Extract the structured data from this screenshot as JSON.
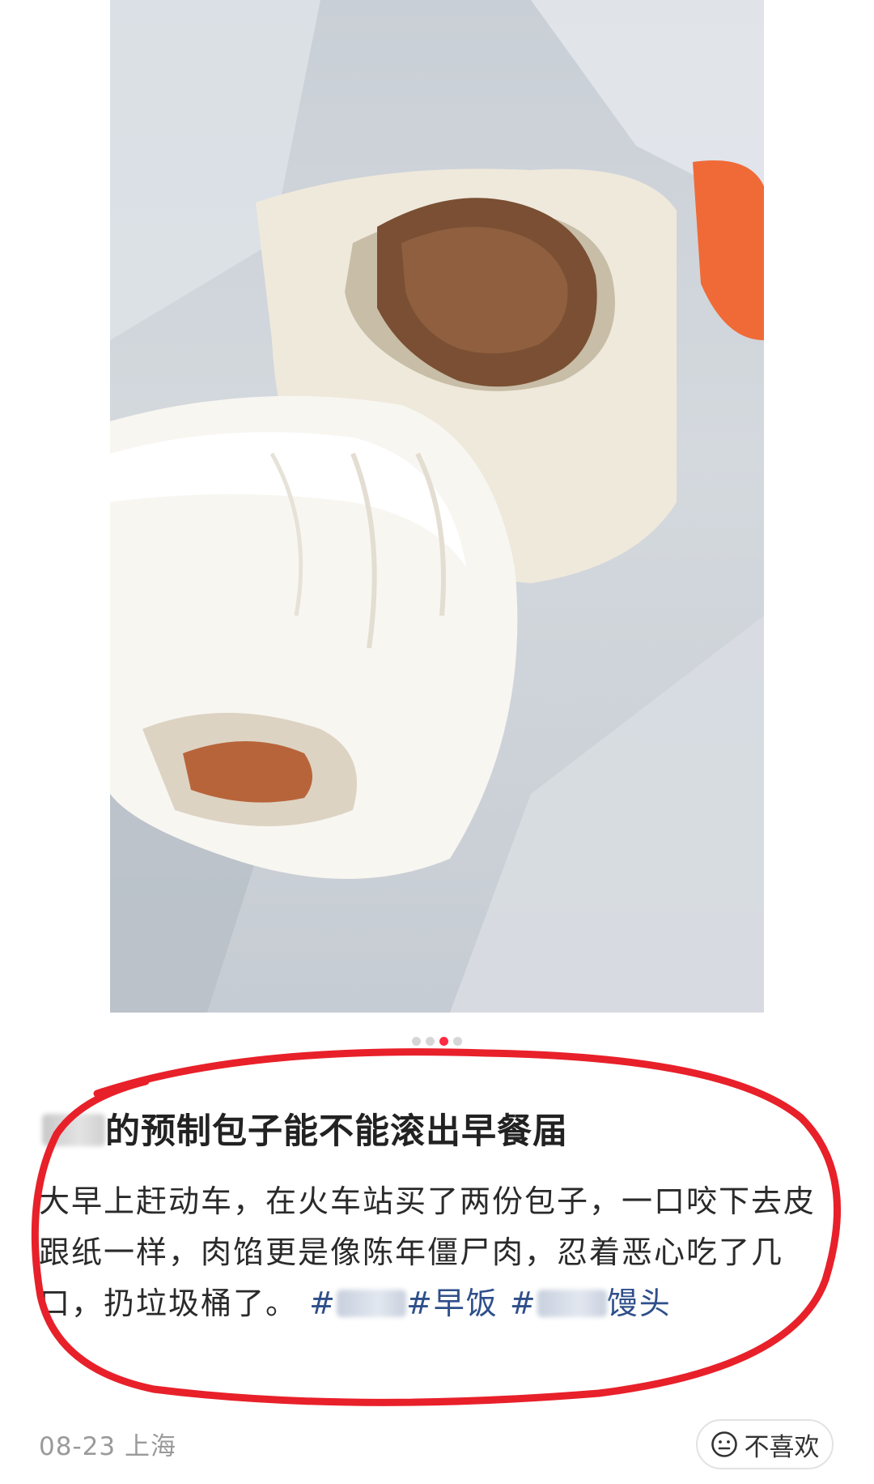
{
  "post": {
    "title": "的预制包子能不能滚出早餐届",
    "content": "大早上赶动车，在火车站买了两份包子，一口咬下去皮跟纸一样，肉馅更是像陈年僵尸肉，忍着恶心吃了几口，扔垃圾桶了。",
    "tags": [
      "#",
      "#早饭",
      "#",
      "馒头"
    ],
    "date": "08-23",
    "location": "上海"
  },
  "carousel": {
    "total": 4,
    "active_index": 3
  },
  "actions": {
    "dislike_label": "不喜欢",
    "dislike_icon": "neutral-face-icon"
  },
  "colors": {
    "accent": "#ff2a44",
    "tag": "#2f4f8a",
    "annotation": "#e8202a"
  }
}
